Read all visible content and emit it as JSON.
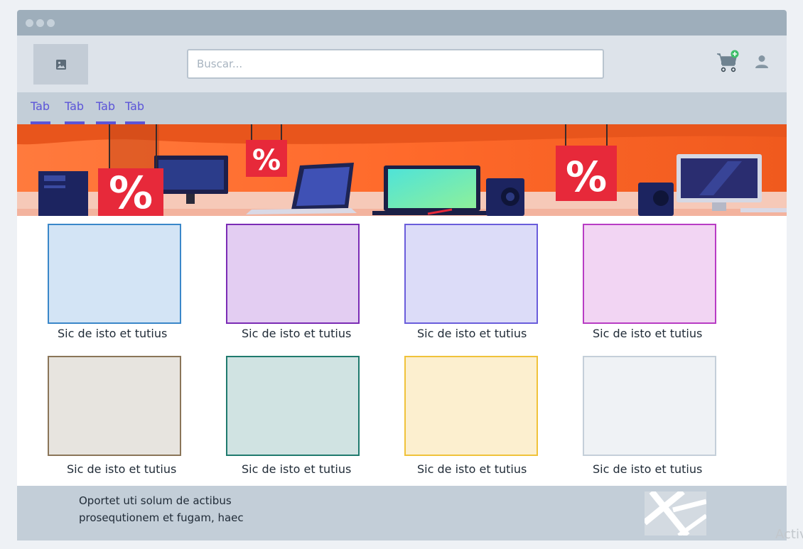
{
  "header": {
    "logo_icon": "image-icon",
    "search_placeholder": "Buscar...",
    "cart_icon": "cart-add-icon",
    "user_icon": "user-icon"
  },
  "tabs": [
    {
      "label": "Tab"
    },
    {
      "label": "Tab"
    },
    {
      "label": "Tab"
    },
    {
      "label": "Tab"
    }
  ],
  "banner": {
    "sign_text": "%"
  },
  "products": [
    {
      "caption": "Sic de isto et tutius",
      "fill": "#d3e4f5",
      "border": "#3a87c9"
    },
    {
      "caption": "Sic de isto et tutius",
      "fill": "#e3cdf2",
      "border": "#7b2bb5"
    },
    {
      "caption": "Sic de isto et tutius",
      "fill": "#dcdcf8",
      "border": "#6a5ddb"
    },
    {
      "caption": "Sic de isto et tutius",
      "fill": "#f2d5f3",
      "border": "#b83cc4"
    },
    {
      "caption": "Sic de isto et tutius",
      "fill": "#e7e4df",
      "border": "#8a7558"
    },
    {
      "caption": "Sic de isto et tutius",
      "fill": "#d0e3e2",
      "border": "#1f7a6e"
    },
    {
      "caption": "Sic de isto et tutius",
      "fill": "#fcefcf",
      "border": "#f0c23a"
    },
    {
      "caption": "Sic de isto et tutius",
      "fill": "#eff2f5",
      "border": "#c4cfd9"
    }
  ],
  "footer": {
    "line1": "Oportet uti solum de actibus",
    "line2": "prosequtionem et fugam, haec",
    "map_icon": "map-icon"
  },
  "watermark": "Activ",
  "colors": {
    "accent": "#5b54d8",
    "titlebar": "#9eaebb",
    "header": "#dde3ea",
    "tabsbar": "#c3ced8"
  }
}
